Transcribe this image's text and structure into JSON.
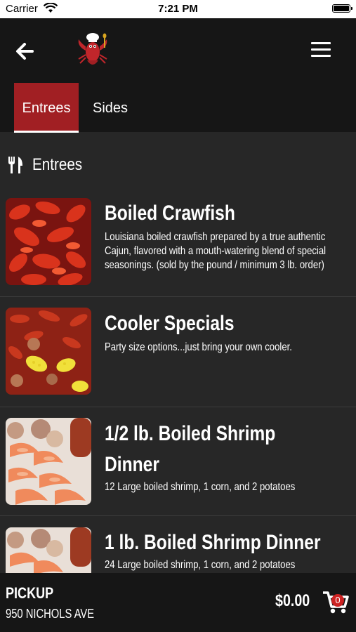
{
  "status_bar": {
    "carrier": "Carrier",
    "time": "7:21 PM"
  },
  "header": {
    "tabs": [
      {
        "label": "Entrees",
        "active": true
      },
      {
        "label": "Sides",
        "active": false
      }
    ]
  },
  "section": {
    "title": "Entrees"
  },
  "menu_items": [
    {
      "name": "Boiled Crawfish",
      "description": "Louisiana boiled crawfish prepared by a true authentic Cajun, flavored with a mouth-watering blend of special seasonings. (sold by the pound / minimum 3 lb. order)"
    },
    {
      "name": "Cooler Specials",
      "description": "Party size options...just bring your own cooler."
    },
    {
      "name": "1/2 lb. Boiled Shrimp",
      "name_line2": "Dinner",
      "description": "12 Large boiled shrimp, 1 corn, and 2 potatoes"
    },
    {
      "name": "1 lb. Boiled Shrimp Dinner",
      "description": "24 Large boiled shrimp, 1 corn, and 2 potatoes"
    }
  ],
  "footer": {
    "pickup_label": "PICKUP",
    "address": "950 NICHOLS AVE",
    "total": "$0.00",
    "cart_count": "0"
  },
  "colors": {
    "accent": "#a11f23",
    "header_bg": "#161616",
    "body_bg": "#272727"
  }
}
